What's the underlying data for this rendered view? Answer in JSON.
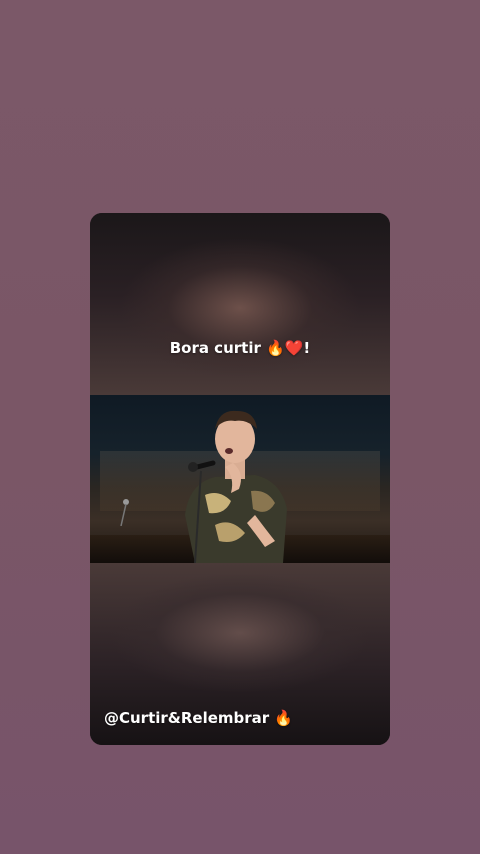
{
  "story": {
    "top_caption": "Bora curtir 🔥❤️!",
    "bottom_caption": "@Curtir&Relembrar 🔥"
  },
  "colors": {
    "page_background": "#7a5666",
    "card_background": "#1a1517",
    "caption_text": "#ffffff"
  },
  "video": {
    "content": "singer-performing-with-microphone"
  }
}
